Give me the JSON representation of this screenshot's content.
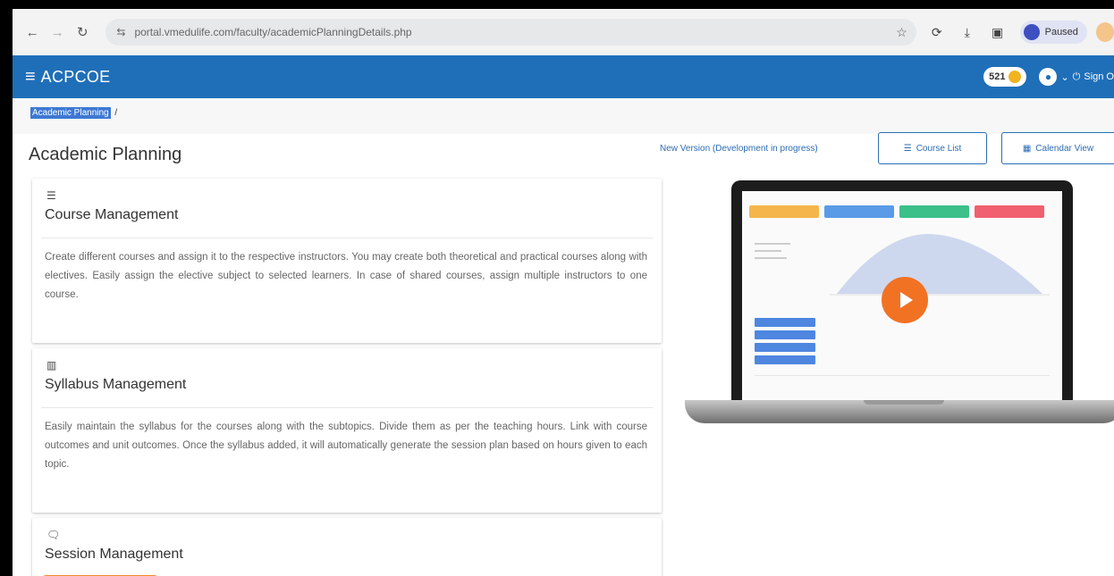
{
  "browser": {
    "url": "portal.vmedulife.com/faculty/academicPlanningDetails.php",
    "profile_label": "Paused"
  },
  "header": {
    "app_title": "ACPCOE",
    "coin_count": "521",
    "sign_out_label": "Sign O"
  },
  "breadcrumb": {
    "current": "Academic Planning",
    "separator": "/"
  },
  "page": {
    "title": "Academic Planning",
    "new_version_link": "New Version (Development in progress)",
    "course_list_button": "Course List",
    "calendar_view_button": "Calendar View"
  },
  "cards": [
    {
      "icon": "list-icon",
      "title": "Course Management",
      "description": "Create different courses and assign it to the respective instructors. You may create both theoretical and practical courses along with electives. Easily assign the elective subject to selected learners. In case of shared courses, assign multiple instructors to one course."
    },
    {
      "icon": "book-icon",
      "title": "Syllabus Management",
      "description": "Easily maintain the syllabus for the courses along with the subtopics. Divide them as per the teaching hours. Link with course outcomes and unit outcomes. Once the syllabus added, it will automatically generate the session plan based on hours given to each topic."
    },
    {
      "icon": "chat-icon",
      "title": "Session Management",
      "description": ""
    }
  ],
  "colors": {
    "header_bg": "#1f6fb8",
    "accent_orange": "#f27224",
    "link_blue": "#2d6db5"
  }
}
